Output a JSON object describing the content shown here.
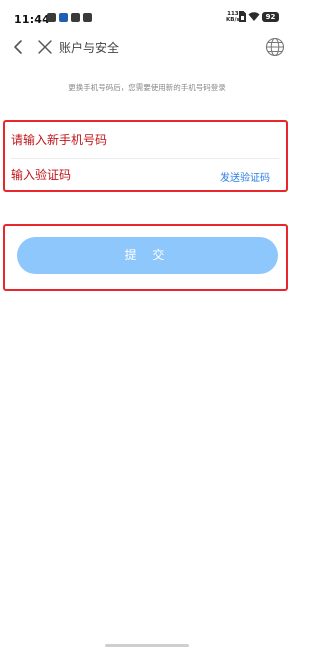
{
  "status_bar": {
    "time": "11:44",
    "net_speed_value": "113",
    "net_speed_unit": "KB/s",
    "battery": "92"
  },
  "nav": {
    "title": "账户与安全",
    "back_icon": "chevron-left-icon",
    "close_icon": "close-icon",
    "globe_icon": "globe-icon"
  },
  "hint": "更换手机号码后，您需要使用新的手机号码登录",
  "form": {
    "phone_placeholder": "请输入新手机号码",
    "code_placeholder": "输入验证码",
    "send_code_label": "发送验证码"
  },
  "submit_label": "提 交",
  "colors": {
    "accent": "#2a7de1",
    "button": "#8ec7fc",
    "annotation": "#e8262b",
    "placeholder": "#c0151a"
  }
}
